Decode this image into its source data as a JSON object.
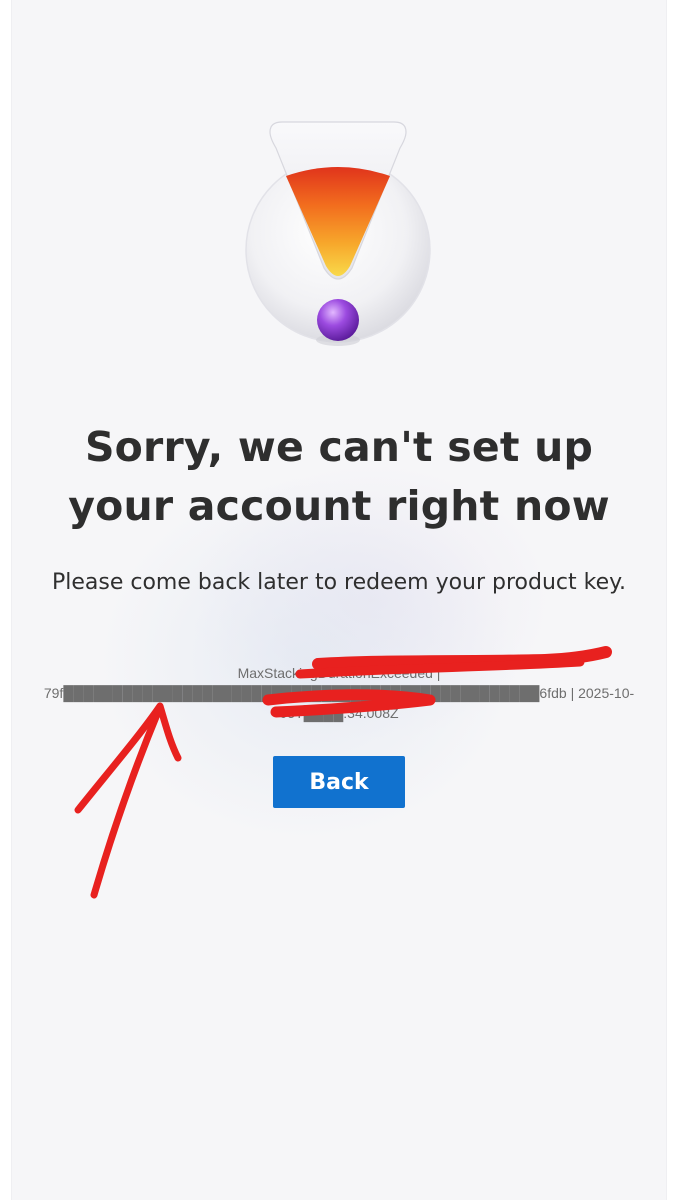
{
  "dialog": {
    "title": "Sorry, we can't set up your account right now",
    "message": "Please come back later to redeem your product key.",
    "error_details": "MaxStackingDurationExceeded | 79f████████████████████████████████████████████████6fdb | 2025-10-05T████:34.008Z",
    "back_label": "Back"
  },
  "icons": {
    "hero": "exclamation-illustration-icon"
  },
  "colors": {
    "primary_button": "#1172cf",
    "annotation_red": "#e8211f",
    "title_text": "#2e2e2e",
    "background": "#f6f6f8"
  }
}
